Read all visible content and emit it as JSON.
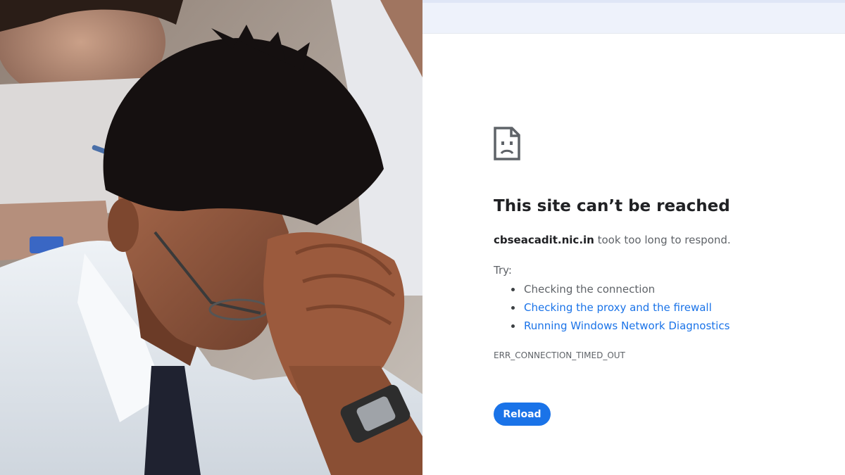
{
  "error_page": {
    "icon": "sad-page-icon",
    "title": "This site can’t be reached",
    "host": "cbseacadit.nic.in",
    "message_suffix": " took too long to respond.",
    "try_label": "Try:",
    "suggestions": [
      {
        "label": "Checking the connection",
        "link": false
      },
      {
        "label": "Checking the proxy and the firewall",
        "link": true
      },
      {
        "label": "Running Windows Network Diagnostics",
        "link": true
      }
    ],
    "error_code": "ERR_CONNECTION_TIMED_OUT",
    "reload_label": "Reload"
  },
  "colors": {
    "accent": "#1a73e8",
    "title_text": "#202124",
    "body_text": "#5f6368"
  }
}
